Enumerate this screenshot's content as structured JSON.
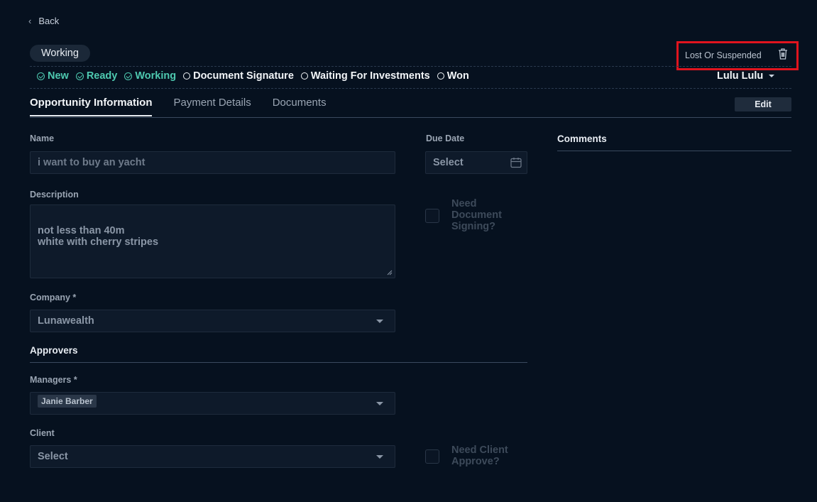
{
  "nav": {
    "back_label": "Back"
  },
  "status": {
    "current": "Working",
    "lost_label": "Lost Or Suspended"
  },
  "steps": [
    {
      "label": "New",
      "done": true
    },
    {
      "label": "Ready",
      "done": true
    },
    {
      "label": "Working",
      "done": true
    },
    {
      "label": "Document Signature",
      "done": false
    },
    {
      "label": "Waiting For Investments",
      "done": false
    },
    {
      "label": "Won",
      "done": false
    }
  ],
  "user": {
    "name": "Lulu Lulu"
  },
  "tabs": [
    {
      "label": "Opportunity Information",
      "active": true
    },
    {
      "label": "Payment Details",
      "active": false
    },
    {
      "label": "Documents",
      "active": false
    }
  ],
  "edit_label": "Edit",
  "form": {
    "name_label": "Name",
    "name_value": "i want to buy an yacht",
    "description_label": "Description",
    "description_value": "not less than 40m\nwhite with cherry stripes",
    "company_label": "Company *",
    "company_value": "Lunawealth",
    "approvers_title": "Approvers",
    "managers_label": "Managers *",
    "manager_chip": "Janie Barber",
    "client_label": "Client",
    "client_value": "Select",
    "due_date_label": "Due Date",
    "due_date_value": "Select",
    "need_doc_label": "Need\nDocument\nSigning?",
    "need_client_label": "Need Client\nApprove?"
  },
  "comments": {
    "title": "Comments"
  },
  "colors": {
    "done_step": "#4ec9b0",
    "highlight_box": "#e0141e",
    "background": "#06111f"
  }
}
